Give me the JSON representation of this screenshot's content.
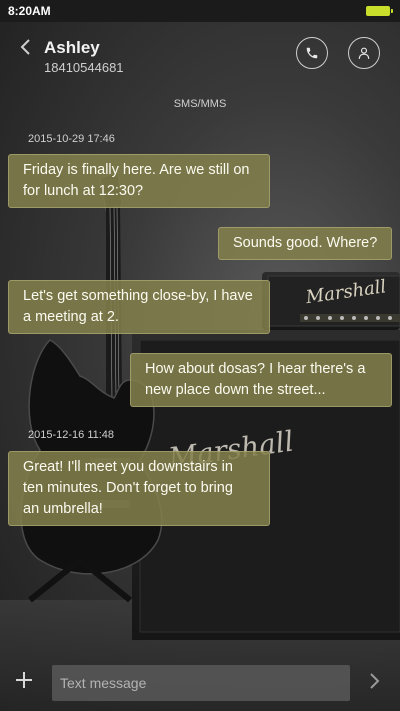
{
  "status_bar": {
    "time": "8:20AM",
    "battery_icon": "battery-icon",
    "battery_color": "#c8de2a"
  },
  "header": {
    "back_icon": "chevron-left-icon",
    "contact_name": "Ashley",
    "contact_number": "18410544681",
    "call_icon": "phone-icon",
    "contact_icon": "person-icon"
  },
  "channel_label": "SMS/MMS",
  "conversation": {
    "timestamps": [
      "2015-10-29 17:46",
      "2015-12-16 11:48"
    ],
    "messages": [
      {
        "direction": "in",
        "lines": [
          "Friday is finally here. Are we still on",
          "for lunch at 12:30?"
        ]
      },
      {
        "direction": "out",
        "lines": [
          "Sounds good. Where?"
        ]
      },
      {
        "direction": "in",
        "lines": [
          "Let's get something close-by, I have",
          "a meeting at 2."
        ]
      },
      {
        "direction": "out",
        "lines": [
          "How about dosas? I hear there's a",
          "new place down the street..."
        ]
      },
      {
        "direction": "in",
        "lines": [
          "Great! I'll meet you downstairs in",
          "ten minutes. Don't forget to bring",
          "an umbrella!"
        ]
      }
    ]
  },
  "background_art": {
    "amp_brand": "Marshall"
  },
  "composer": {
    "add_icon": "plus-icon",
    "placeholder": "Text message",
    "value": "",
    "send_icon": "chevron-right-icon"
  },
  "colors": {
    "bubble": "#84804c",
    "status_bar": "#1b1b1b",
    "accent_battery": "#c8de2a"
  }
}
